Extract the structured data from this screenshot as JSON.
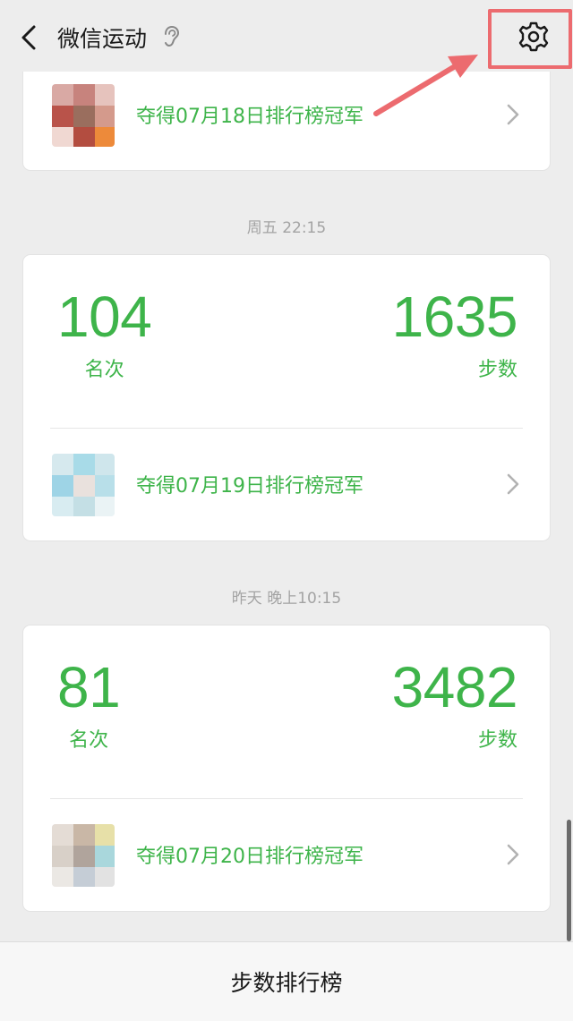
{
  "header": {
    "title": "微信运动",
    "back_icon": "chevron-left-icon",
    "ear_icon": "ear-icon",
    "settings_icon": "gear-icon"
  },
  "colors": {
    "accent_green": "#3eb44a",
    "highlight_red": "#ec6b6f",
    "background": "#ededed"
  },
  "feed": {
    "top_card": {
      "champion_text": "夺得07月18日排行榜冠军"
    },
    "entries": [
      {
        "timestamp": "周五 22:15",
        "rank": "104",
        "rank_label": "名次",
        "steps": "1635",
        "steps_label": "步数",
        "champion_text": "夺得07月19日排行榜冠军"
      },
      {
        "timestamp": "昨天 晚上10:15",
        "rank": "81",
        "rank_label": "名次",
        "steps": "3482",
        "steps_label": "步数",
        "champion_text": "夺得07月20日排行榜冠军"
      }
    ]
  },
  "bottom_bar": {
    "label": "步数排行榜"
  }
}
